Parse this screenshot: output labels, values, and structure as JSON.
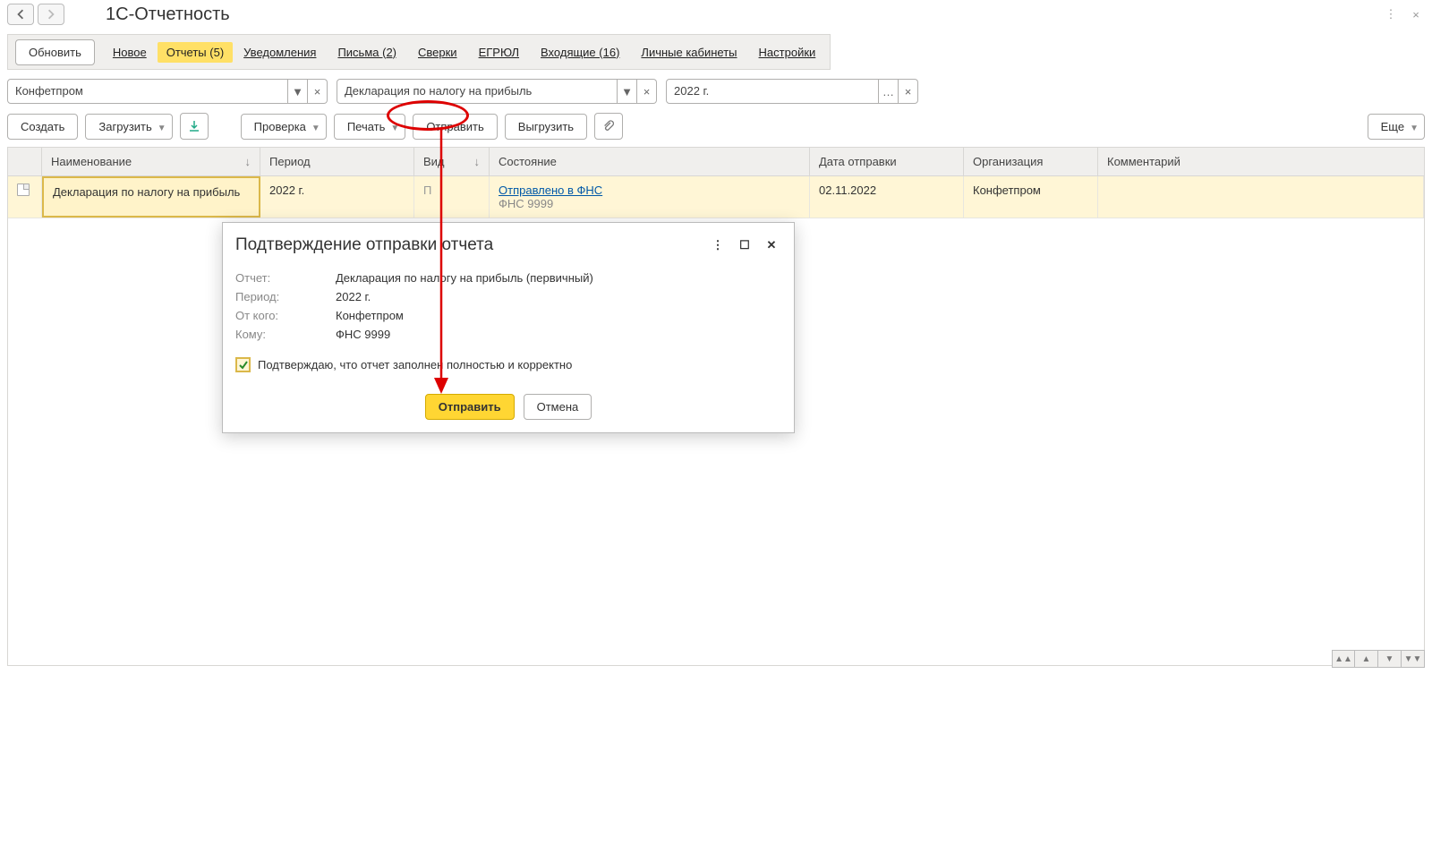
{
  "title": "1С-Отчетность",
  "nav": {
    "refresh": "Обновить",
    "new": "Новое",
    "reports": "Отчеты (5)",
    "notifications": "Уведомления",
    "letters": "Письма (2)",
    "sverki": "Сверки",
    "egrul": "ЕГРЮЛ",
    "incoming": "Входящие (16)",
    "cabinets": "Личные кабинеты",
    "settings": "Настройки"
  },
  "filters": {
    "org": "Конфетпром",
    "report": "Декларация по налогу на прибыль",
    "period": "2022 г."
  },
  "toolbar": {
    "create": "Создать",
    "load": "Загрузить",
    "check": "Проверка",
    "print": "Печать",
    "send": "Отправить",
    "export": "Выгрузить",
    "more": "Еще"
  },
  "columns": {
    "name": "Наименование",
    "period": "Период",
    "vid": "Вид",
    "state": "Состояние",
    "date": "Дата отправки",
    "org": "Организация",
    "comment": "Комментарий"
  },
  "row": {
    "name": "Декларация по налогу на прибыль",
    "period": "2022 г.",
    "vid": "П",
    "state_link": "Отправлено в ФНС",
    "state_sub": "ФНС 9999",
    "date": "02.11.2022",
    "org": "Конфетпром"
  },
  "dialog": {
    "title": "Подтверждение отправки отчета",
    "labels": {
      "report": "Отчет:",
      "period": "Период:",
      "from": "От кого:",
      "to": "Кому:"
    },
    "report": "Декларация по налогу на прибыль (первичный)",
    "period": "2022 г.",
    "from": "Конфетпром",
    "to": "ФНС 9999",
    "confirm_text": "Подтверждаю, что отчет заполнен полностью и корректно",
    "send": "Отправить",
    "cancel": "Отмена"
  }
}
